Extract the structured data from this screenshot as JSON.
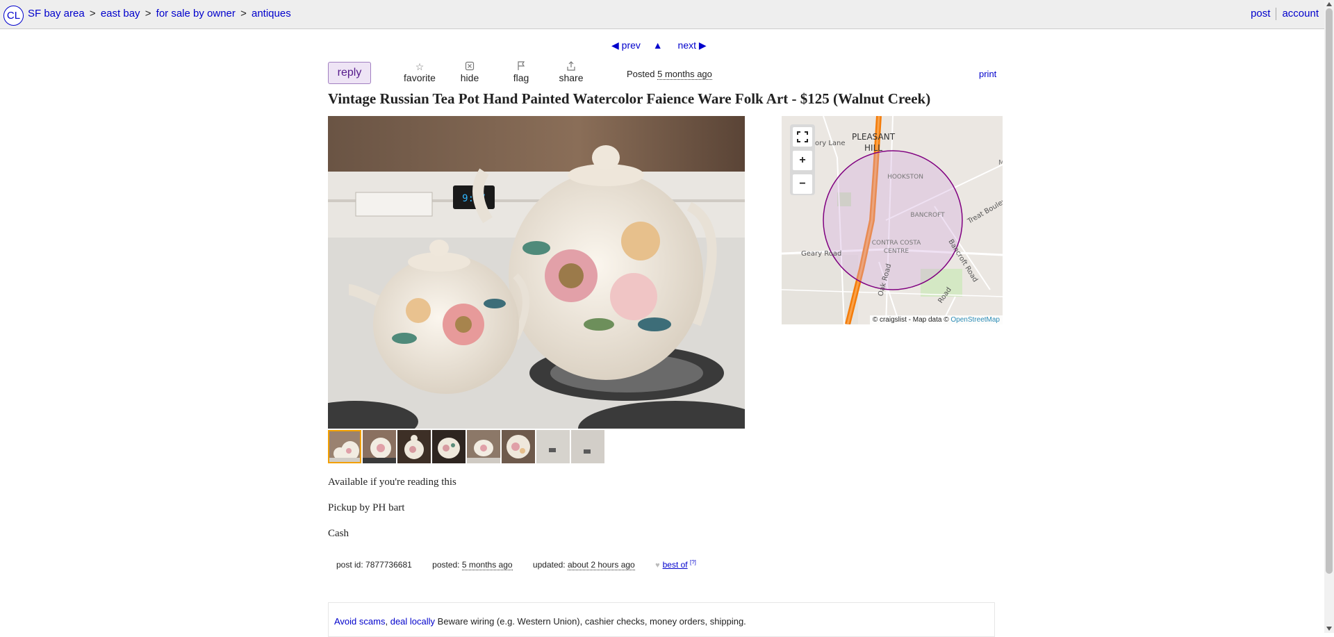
{
  "header": {
    "logo": "CL",
    "breadcrumbs": [
      "SF bay area",
      "east bay",
      "for sale by owner",
      "antiques"
    ],
    "crumb_separator": ">",
    "post_link": "post",
    "account_link": "account"
  },
  "nav": {
    "prev": "◀ prev",
    "up": "▲",
    "next": "next ▶"
  },
  "actions": {
    "reply": "reply",
    "favorite": "favorite",
    "hide": "hide",
    "flag": "flag",
    "share": "share",
    "posted_label": "Posted",
    "posted_time": "5 months ago",
    "print": "print"
  },
  "listing": {
    "title": "Vintage Russian Tea Pot Hand Painted Watercolor Faience Ware Folk Art - $125 (Walnut Creek)",
    "stove_clock": "9:37",
    "thumbnail_count": 8,
    "selected_thumbnail": 1
  },
  "map": {
    "labels": {
      "pleasant": "PLEASANT",
      "hill": "HILL",
      "hookston": "HOOKSTON",
      "bancroft": "BANCROFT",
      "contra": "CONTRA COSTA",
      "centre": "CENTRE",
      "geary": "Geary Road",
      "oak": "Oak Road",
      "bancroft_road": "Bancroft Road",
      "treat": "Treat Boulev",
      "lane": "ory Lane",
      "road2": "Road",
      "m": "M"
    },
    "zoom_in": "+",
    "zoom_out": "−",
    "attribution": "© craigslist - Map data ©",
    "attribution_link": "OpenStreetMap"
  },
  "body": {
    "lines": [
      "Available if you're reading this",
      "Pickup by PH bart",
      "Cash"
    ]
  },
  "postinfo": {
    "post_id_label": "post id:",
    "post_id": "7877736681",
    "posted_label": "posted:",
    "posted_time": "5 months ago",
    "updated_label": "updated:",
    "updated_time": "about 2 hours ago",
    "best_of": "best of",
    "best_of_help": "[?]"
  },
  "notice": {
    "avoid_scams": "Avoid scams",
    "comma": ",",
    "deal_locally": "deal locally",
    "text": "Beware wiring (e.g. Western Union), cashier checks, money orders, shipping."
  },
  "colors": {
    "link": "#0000cc",
    "reply_bg": "#eee4f5",
    "reply_border": "#a17fc1",
    "map_highway": "#f47c0a",
    "map_circle": "#800080",
    "thumb_selected": "#f2a000"
  }
}
